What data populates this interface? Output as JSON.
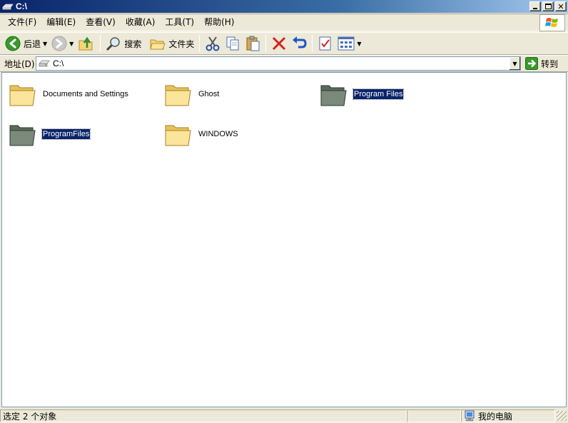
{
  "window": {
    "title": "C:\\"
  },
  "menu": [
    "文件(F)",
    "编辑(E)",
    "查看(V)",
    "收藏(A)",
    "工具(T)",
    "帮助(H)"
  ],
  "toolbar": {
    "back_label": "后退",
    "search_label": "搜索",
    "folders_label": "文件夹"
  },
  "address": {
    "label": "地址(D)",
    "value": "C:\\",
    "go_label": "转到"
  },
  "items": [
    {
      "name": "Documents and Settings",
      "type": "folder",
      "selected": false
    },
    {
      "name": "Ghost",
      "type": "folder",
      "selected": false
    },
    {
      "name": "Program Files",
      "type": "folder-gray",
      "selected": true
    },
    {
      "name": "ProgramFiles",
      "type": "folder-gray",
      "selected": true
    },
    {
      "name": "WINDOWS",
      "type": "folder",
      "selected": false
    }
  ],
  "status": {
    "text": "选定 2 个对象",
    "zone": "我的电脑"
  },
  "colors": {
    "selection": "#0a246a",
    "title_start": "#0a246a",
    "title_end": "#a6caf0"
  }
}
